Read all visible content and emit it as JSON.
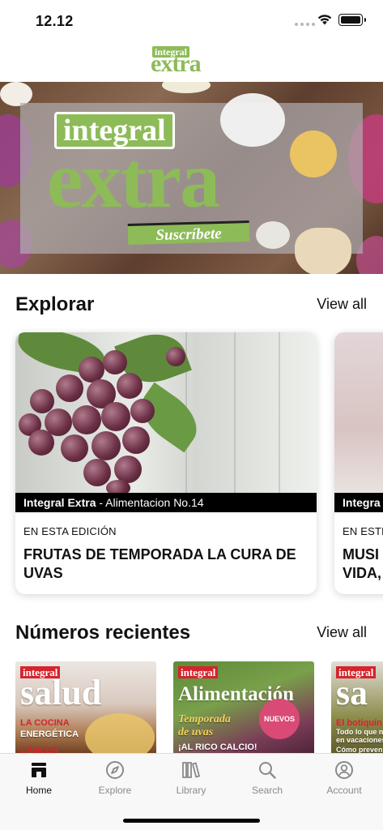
{
  "status_bar": {
    "time": "12.12"
  },
  "app_logo": {
    "small": "integral",
    "big": "extra"
  },
  "hero": {
    "brand_small": "integral",
    "brand_big": "extra",
    "subscribe": "Suscríbete"
  },
  "explore": {
    "title": "Explorar",
    "view_all": "View all",
    "cards": [
      {
        "publication": "Integral Extra",
        "separator": " - ",
        "issue": "Alimentacion No.14",
        "kicker": "EN ESTA EDICIÓN",
        "title": "FRUTAS DE TEMPORADA LA CURA DE UVAS"
      },
      {
        "publication": "Integra",
        "kicker": "EN ESTE",
        "title_line1": "MUSI",
        "title_line2": "VIDA,"
      }
    ]
  },
  "recent": {
    "title": "Números recientes",
    "view_all": "View all",
    "covers": [
      {
        "brand": "integral",
        "title": "salud",
        "line1": "LA COCINA",
        "line2": "ENERGÉTICA",
        "line3": "CÁNCER"
      },
      {
        "brand": "integral",
        "title": "Alimentación",
        "line1": "Temporada",
        "line2": "de uvas",
        "line3": "¡AL RICO CALCIO!",
        "badge": "NUEVOS"
      },
      {
        "brand": "integral",
        "title": "sa",
        "line1": "El botiquín d",
        "line2": "Todo lo que ne",
        "line3": "en vacaciones",
        "line4": "Cómo preven"
      }
    ]
  },
  "tab_bar": {
    "tabs": [
      {
        "label": "Home",
        "icon": "home-icon",
        "active": true
      },
      {
        "label": "Explore",
        "icon": "compass-icon",
        "active": false
      },
      {
        "label": "Library",
        "icon": "library-icon",
        "active": false
      },
      {
        "label": "Search",
        "icon": "search-icon",
        "active": false
      },
      {
        "label": "Account",
        "icon": "account-icon",
        "active": false
      }
    ]
  },
  "colors": {
    "brand_green": "#8dbb58",
    "brand_red": "#d5242e",
    "tab_active": "#111111",
    "tab_inactive": "#8a8a8a"
  }
}
